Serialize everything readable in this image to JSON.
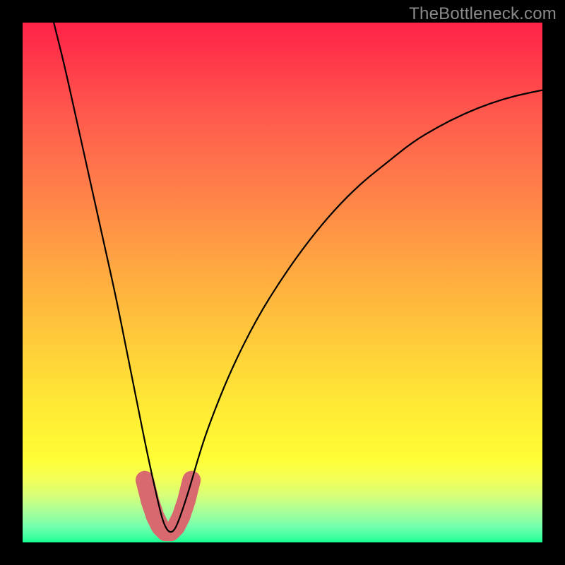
{
  "watermark": "TheBottleneck.com",
  "chart_data": {
    "type": "line",
    "title": "",
    "xlabel": "",
    "ylabel": "",
    "xlim": [
      0,
      100
    ],
    "ylim": [
      0,
      100
    ],
    "series": [
      {
        "name": "bottleneck-curve",
        "x": [
          6,
          8,
          10,
          12,
          14,
          16,
          18,
          20,
          22,
          24,
          26,
          27,
          28,
          29,
          30,
          32,
          34,
          36,
          40,
          45,
          50,
          55,
          60,
          65,
          70,
          75,
          80,
          85,
          90,
          95,
          100
        ],
        "y": [
          100,
          92,
          83,
          74,
          65,
          56,
          47,
          37,
          27,
          17,
          8,
          4,
          2,
          2,
          4,
          10,
          17,
          23,
          33,
          43,
          51,
          58,
          64,
          69,
          73,
          77,
          80,
          82.5,
          84.5,
          86,
          87
        ]
      },
      {
        "name": "highlight-band",
        "x": [
          23.5,
          24.5,
          25.5,
          26.5,
          27.5,
          28.5,
          29.5,
          30.5,
          31.5,
          32.5
        ],
        "y": [
          12,
          8,
          5,
          3,
          2,
          2,
          3,
          5,
          8,
          12
        ]
      }
    ],
    "colors": {
      "curve": "#000000",
      "highlight": "#d86a6f"
    }
  }
}
